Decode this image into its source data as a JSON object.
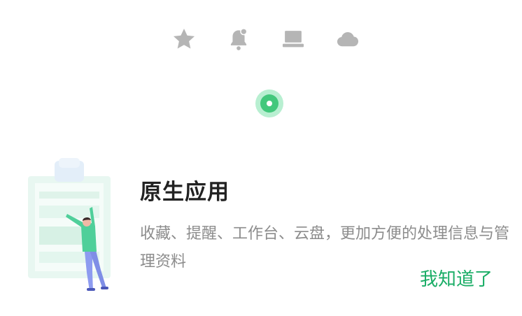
{
  "tour": {
    "icons": [
      "star-icon",
      "bell-icon",
      "laptop-icon",
      "cloud-icon"
    ],
    "title": "原生应用",
    "description": "收藏、提醒、工作台、云盘，更加方便的处理信息与管理资料",
    "confirm_label": "我知道了"
  },
  "colors": {
    "icon_gray": "#b5b5b5",
    "accent_green": "#1aad66",
    "indicator_green": "#42c87c",
    "indicator_halo": "#b8efd1",
    "title_text": "#222222",
    "body_text": "#8c8c8c"
  }
}
